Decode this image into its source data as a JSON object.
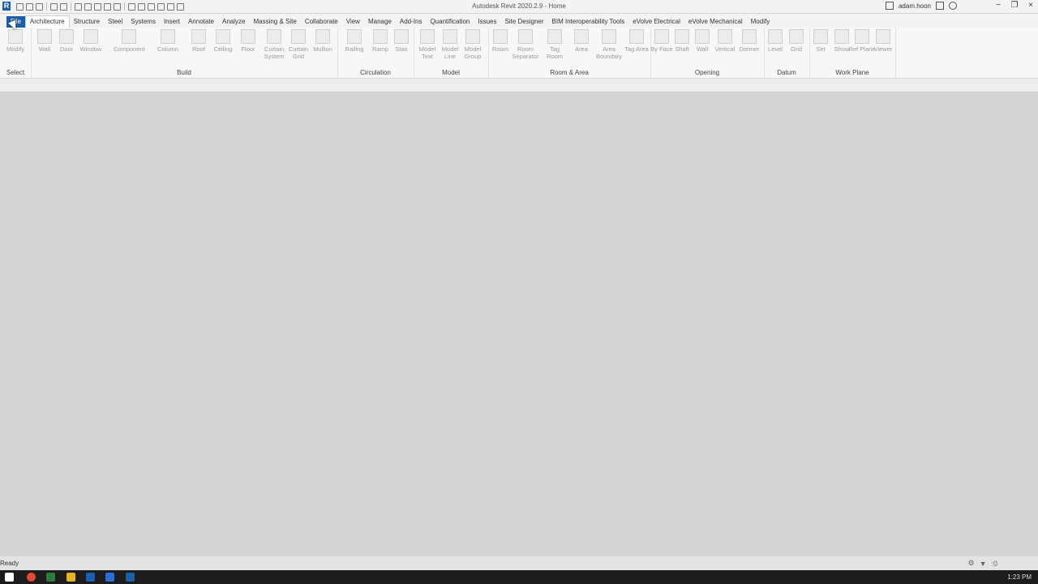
{
  "titlebar": {
    "logo_letter": "R",
    "title": "Autodesk Revit 2020.2.9 - Home",
    "user": "adam.hoon",
    "window_controls": [
      "−",
      "❐",
      "×"
    ]
  },
  "tabs": [
    "File",
    "Architecture",
    "Structure",
    "Steel",
    "Systems",
    "Insert",
    "Annotate",
    "Analyze",
    "Massing & Site",
    "Collaborate",
    "View",
    "Manage",
    "Add-Ins",
    "Quantification",
    "Issues",
    "Site Designer",
    "BIM Interoperability Tools",
    "eVolve Electrical",
    "eVolve Mechanical",
    "Modify"
  ],
  "active_tab": "Architecture",
  "ribbon": {
    "select": {
      "label": "Select",
      "tools": [
        "Modify"
      ]
    },
    "build": {
      "label": "Build",
      "tools": [
        "Wall",
        "Door",
        "Window",
        "Component",
        "Column",
        "Roof",
        "Ceiling",
        "Floor",
        "Curtain System",
        "Curtain Grid",
        "Mullion"
      ]
    },
    "circulation": {
      "label": "Circulation",
      "tools": [
        "Railing",
        "Ramp",
        "Stair"
      ]
    },
    "model": {
      "label": "Model",
      "tools": [
        "Model Text",
        "Model Line",
        "Model Group"
      ]
    },
    "room_area": {
      "label": "Room & Area",
      "tools": [
        "Room",
        "Room Separator",
        "Tag Room",
        "Area",
        "Area Boundary",
        "Tag Area"
      ]
    },
    "opening": {
      "label": "Opening",
      "tools": [
        "By Face",
        "Shaft",
        "Wall",
        "Vertical",
        "Dormer"
      ]
    },
    "datum": {
      "label": "Datum",
      "tools": [
        "Level",
        "Grid"
      ]
    },
    "work_plane": {
      "label": "Work Plane",
      "tools": [
        "Set",
        "Show",
        "Ref Plane",
        "Viewer"
      ]
    }
  },
  "status": {
    "text": "Ready",
    "filter_count": ":0"
  },
  "taskbar": {
    "clock": "1:23 PM"
  }
}
